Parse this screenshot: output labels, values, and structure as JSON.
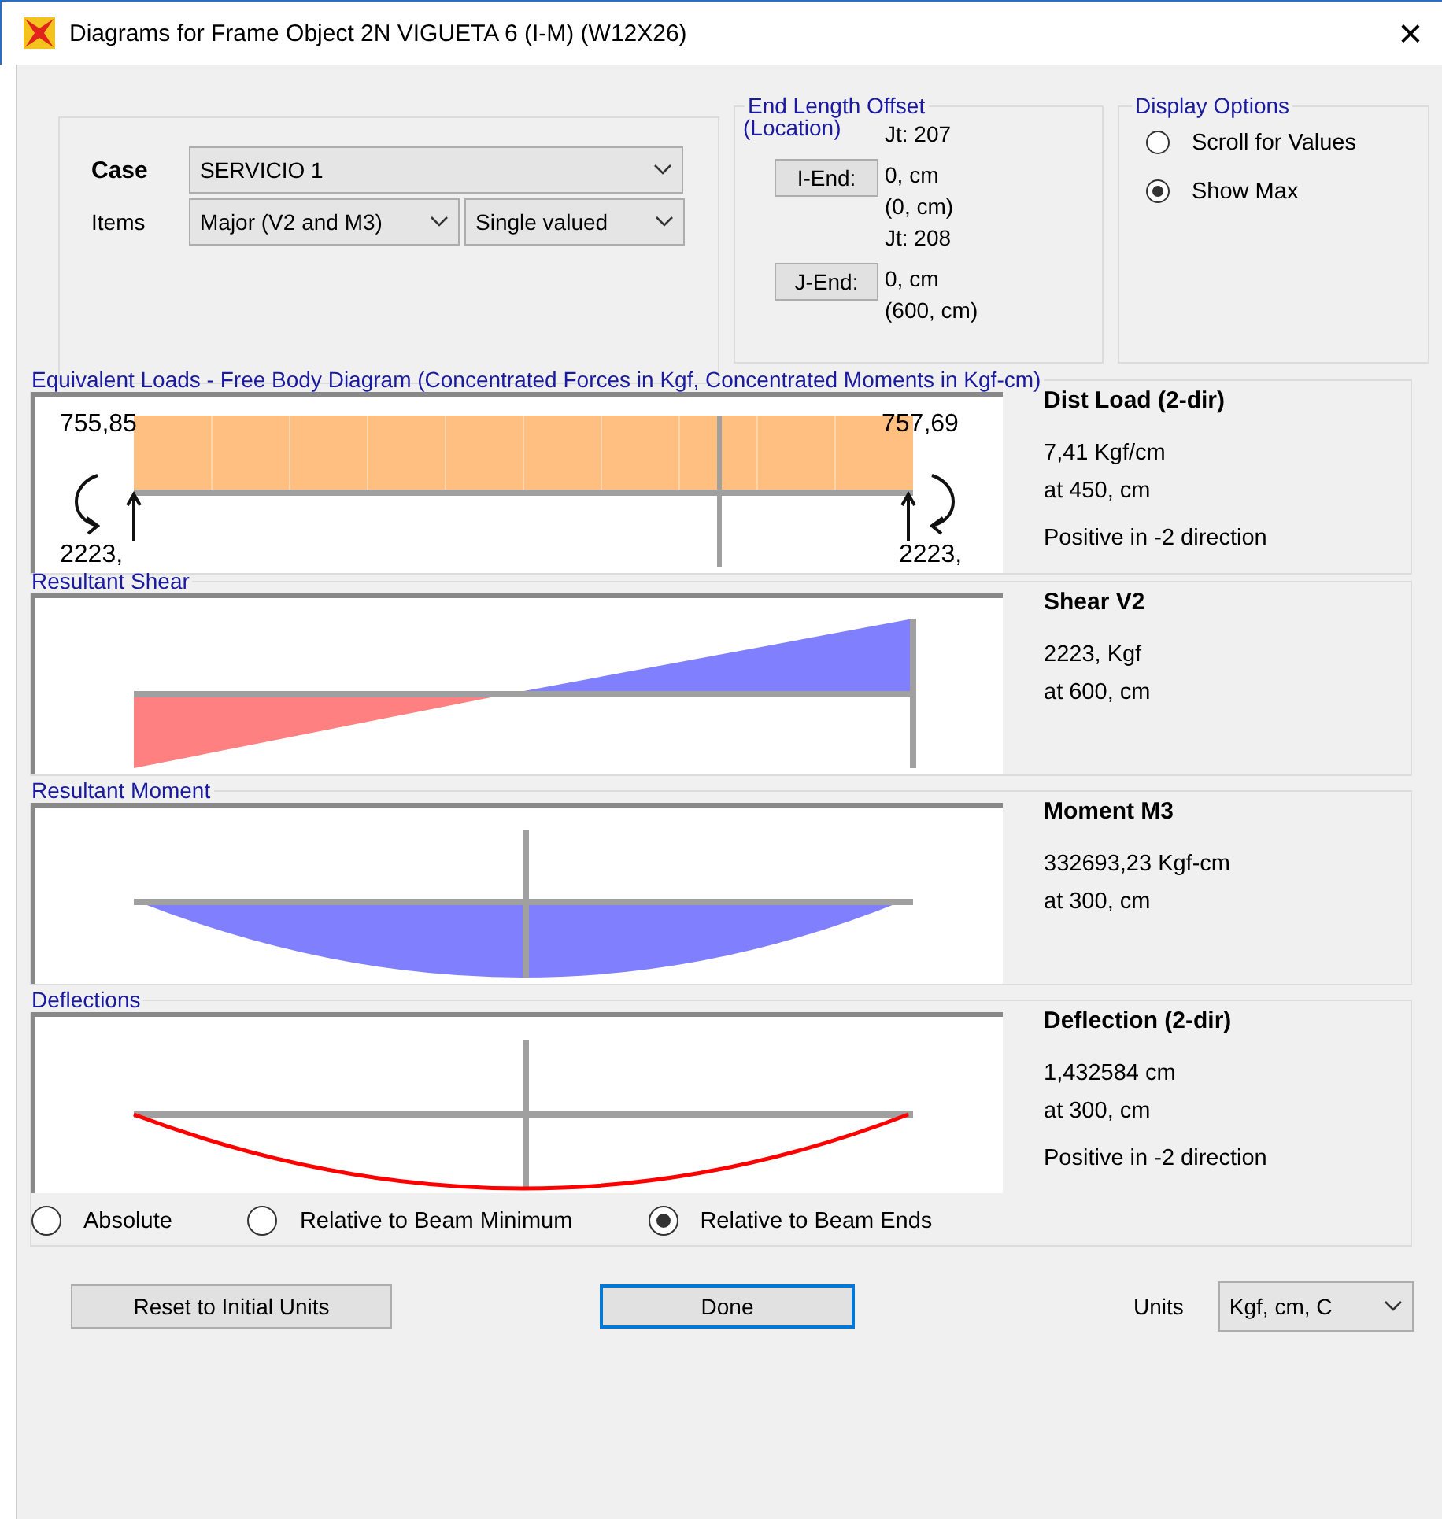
{
  "window": {
    "title": "Diagrams for Frame Object 2N VIGUETA 6 (I-M)  (W12X26)",
    "close": "×"
  },
  "case": {
    "label": "Case",
    "value": "SERVICIO 1"
  },
  "items": {
    "label": "Items",
    "component": "Major (V2 and M3)",
    "valuation": "Single valued"
  },
  "end_length_offset": {
    "title": "End Length Offset",
    "subtitle": "(Location)",
    "ends": [
      {
        "joint": "Jt:  207",
        "button": "I-End:",
        "offset": "0, cm",
        "location": "(0, cm)"
      },
      {
        "joint": "Jt:  208",
        "button": "J-End:",
        "offset": "0, cm",
        "location": "(600, cm)"
      }
    ]
  },
  "display_options": {
    "title": "Display Options",
    "options": [
      {
        "label": "Scroll for Values",
        "selected": false
      },
      {
        "label": "Show Max",
        "selected": true
      }
    ]
  },
  "panels": [
    {
      "kind": "loads",
      "title": "Equivalent Loads - Free Body Diagram  (Concentrated Forces in Kgf, Concentrated Moments in Kgf-cm)",
      "end_values": [
        "755,85",
        "757,69",
        "2223,",
        "2223,"
      ],
      "heading": "Dist Load (2-dir)",
      "lines": [
        "7,41 Kgf/cm",
        "at 450, cm",
        "Positive in -2 direction"
      ]
    },
    {
      "kind": "shear",
      "title": "Resultant Shear",
      "heading": "Shear V2",
      "lines": [
        "2223, Kgf",
        "at 600, cm"
      ]
    },
    {
      "kind": "moment",
      "title": "Resultant Moment",
      "heading": "Moment M3",
      "lines": [
        "332693,23 Kgf-cm",
        "at 300, cm"
      ]
    },
    {
      "kind": "deflection",
      "title": "Deflections",
      "heading": "Deflection (2-dir)",
      "lines": [
        "1,432584 cm",
        "at 300, cm",
        "Positive in -2 direction"
      ],
      "modes": [
        {
          "label": "Absolute",
          "selected": false
        },
        {
          "label": "Relative to Beam Minimum",
          "selected": false
        },
        {
          "label": "Relative to Beam Ends",
          "selected": true
        }
      ]
    }
  ],
  "buttons": [
    {
      "label": "Reset to Initial Units",
      "focused": false
    },
    {
      "label": "Done",
      "focused": true
    }
  ],
  "units": {
    "label": "Units",
    "value": "Kgf, cm, C"
  }
}
